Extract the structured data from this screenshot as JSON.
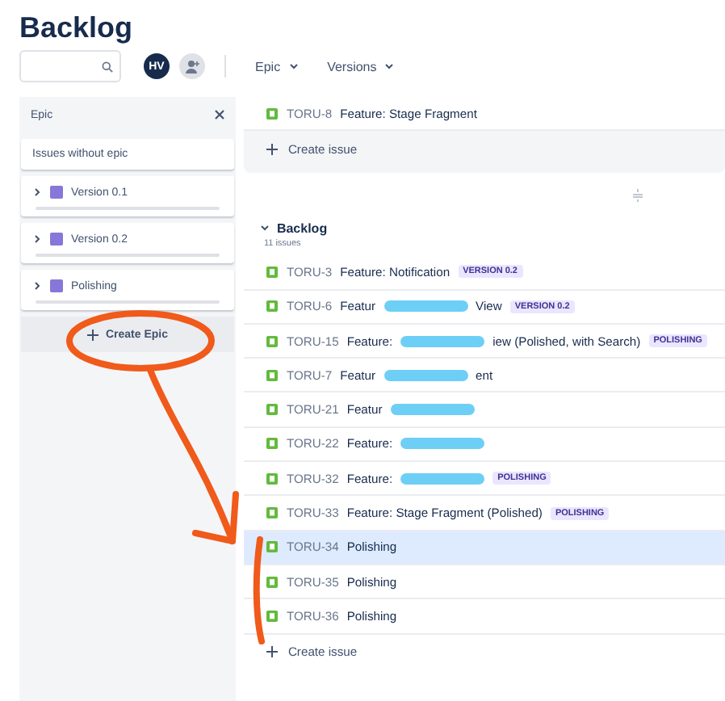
{
  "title": "Backlog",
  "toolbar": {
    "avatar": "HV",
    "filters": [
      {
        "label": "Epic"
      },
      {
        "label": "Versions"
      }
    ]
  },
  "epic_panel": {
    "title": "Epic",
    "no_epic": "Issues without epic",
    "epics": [
      {
        "name": "Version 0.1",
        "color": "#8777d9",
        "expanded": false
      },
      {
        "name": "Version 0.2",
        "color": "#8777d9",
        "expanded": false
      },
      {
        "name": "Polishing",
        "color": "#8777d9",
        "expanded": false
      }
    ],
    "create_label": "Create Epic"
  },
  "sprint": {
    "issues": [
      {
        "key": "TORU-8",
        "parts": [
          {
            "kind": "text",
            "text": "Feature: Stage Fragment"
          }
        ],
        "selected": false
      }
    ],
    "create_label": "Create issue"
  },
  "backlog": {
    "title": "Backlog",
    "expanded": true,
    "count": "11 issues",
    "create_label": "Create issue",
    "issues": [
      {
        "key": "TORU-3",
        "parts": [
          {
            "kind": "text",
            "text": "Feature: Notification"
          }
        ],
        "epic": "VERSION 0.2",
        "selected": false
      },
      {
        "key": "TORU-6",
        "parts": [
          {
            "kind": "text",
            "text": "Featur"
          },
          {
            "kind": "redacted"
          },
          {
            "kind": "text",
            "text": "View"
          }
        ],
        "epic": "VERSION 0.2",
        "selected": false
      },
      {
        "key": "TORU-15",
        "parts": [
          {
            "kind": "text",
            "text": "Feature:"
          },
          {
            "kind": "redacted"
          },
          {
            "kind": "text",
            "text": "iew (Polished, with Search)"
          }
        ],
        "epic": "POLISHING",
        "selected": false
      },
      {
        "key": "TORU-7",
        "parts": [
          {
            "kind": "text",
            "text": "Featur"
          },
          {
            "kind": "redacted"
          },
          {
            "kind": "text",
            "text": "ent"
          }
        ],
        "selected": false
      },
      {
        "key": "TORU-21",
        "parts": [
          {
            "kind": "text",
            "text": "Featur"
          },
          {
            "kind": "redacted"
          }
        ],
        "selected": false
      },
      {
        "key": "TORU-22",
        "parts": [
          {
            "kind": "text",
            "text": "Feature:"
          },
          {
            "kind": "redacted"
          }
        ],
        "selected": false
      },
      {
        "key": "TORU-32",
        "parts": [
          {
            "kind": "text",
            "text": "Feature:"
          },
          {
            "kind": "redacted"
          }
        ],
        "epic": "POLISHING",
        "selected": false
      },
      {
        "key": "TORU-33",
        "parts": [
          {
            "kind": "text",
            "text": "Feature: Stage Fragment (Polished)"
          }
        ],
        "epic": "POLISHING",
        "selected": false
      },
      {
        "key": "TORU-34",
        "parts": [
          {
            "kind": "text",
            "text": "Polishing"
          }
        ],
        "selected": true
      },
      {
        "key": "TORU-35",
        "parts": [
          {
            "kind": "text",
            "text": "Polishing"
          }
        ],
        "selected": false
      },
      {
        "key": "TORU-36",
        "parts": [
          {
            "kind": "text",
            "text": "Polishing"
          }
        ],
        "selected": false
      }
    ]
  }
}
